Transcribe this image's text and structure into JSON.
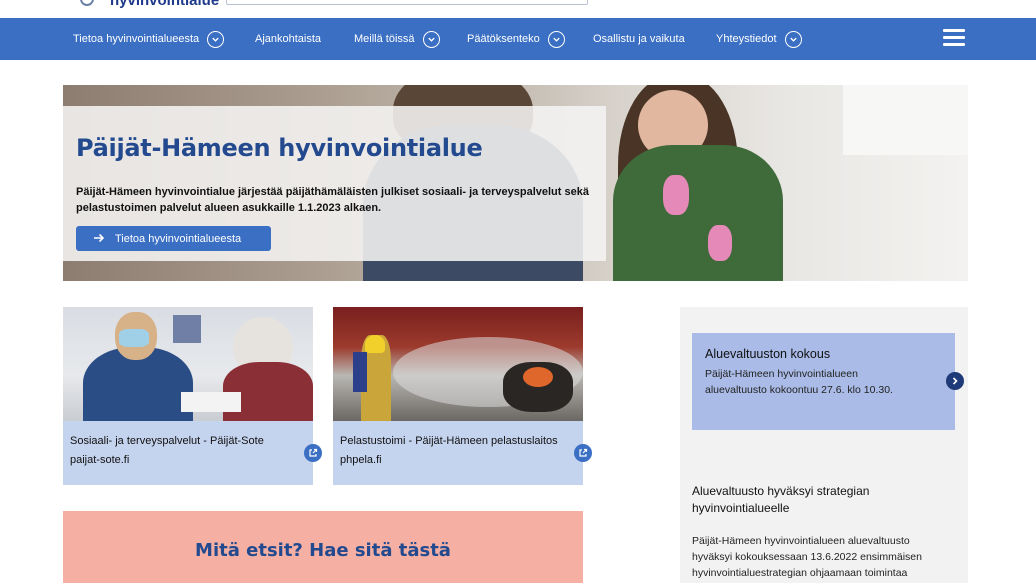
{
  "header": {
    "logo_text": "hyvinvointialue",
    "search_placeholder": ""
  },
  "nav": {
    "items": [
      {
        "label": "Tietoa hyvinvointialueesta",
        "has_dropdown": true
      },
      {
        "label": "Ajankohtaista",
        "has_dropdown": false
      },
      {
        "label": "Meillä töissä",
        "has_dropdown": true
      },
      {
        "label": "Päätöksenteko",
        "has_dropdown": true
      },
      {
        "label": "Osallistu ja vaikuta",
        "has_dropdown": false
      },
      {
        "label": "Yhteystiedot",
        "has_dropdown": true
      }
    ],
    "menu_icon": "hamburger-menu-icon"
  },
  "hero": {
    "title": "Päijät-Hämeen hyvinvointialue",
    "text": "Päijät-Hämeen hyvinvointialue järjestää päijäthämäläisten julkiset sosiaali- ja terveyspalvelut sekä pelastustoimen palvelut alueen asukkaille 1.1.2023 alkaen.",
    "button_label": "Tietoa hyvinvointialueesta",
    "button_icon": "arrow-right-icon"
  },
  "cards": [
    {
      "title": "Sosiaali- ja terveyspalvelut - Päijät-Sote",
      "subtitle": "paijat-sote.fi",
      "icon": "external-link-icon"
    },
    {
      "title": "Pelastustoimi - Päijät-Hämeen pelastuslaitos",
      "subtitle": "phpela.fi",
      "icon": "external-link-icon"
    }
  ],
  "sidebar": {
    "highlight": {
      "title": "Aluevaltuuston kokous",
      "text": "Päijät-Hämeen hyvinvointialueen aluevaltuusto kokoontuu 27.6. klo 10.30."
    },
    "next_icon": "chevron-right-icon",
    "news": {
      "title": "Aluevaltuusto hyväksyi strategian hyvinvointialueelle",
      "text": "Päijät-Hämeen hyvinvointialueen aluevaltuusto hyväksyi kokouksessaan 13.6.2022 ensimmäisen hyvinvointialuestrategian ohjaamaan toimintaa"
    }
  },
  "promo": {
    "text": "Mitä etsit? Hae sitä tästä"
  },
  "colors": {
    "brand_blue": "#3a6fc4",
    "title_blue": "#234a8f",
    "card_bg": "#c5d4ee",
    "highlight_bg": "#a9bbe6",
    "promo_bg": "#f5b0a3"
  }
}
